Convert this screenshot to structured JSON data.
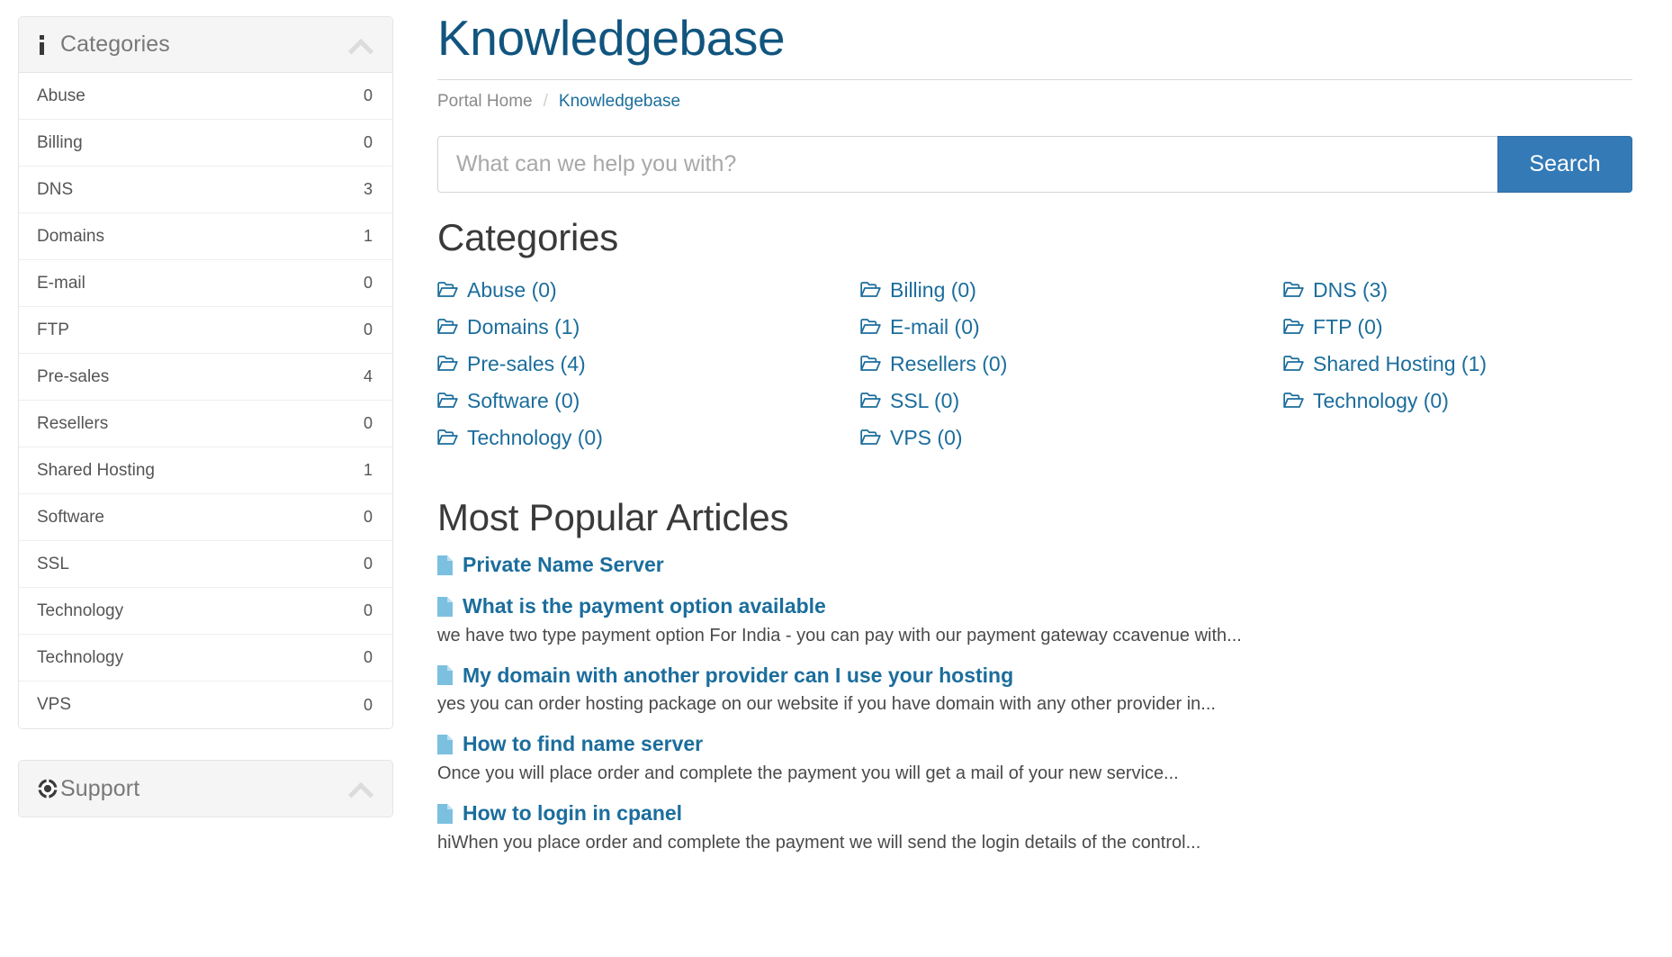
{
  "sidebar": {
    "categories_panel": {
      "icon": "info-icon",
      "title": "Categories",
      "collapse_icon": "chevron-up-icon",
      "items": [
        {
          "label": "Abuse",
          "count": "0"
        },
        {
          "label": "Billing",
          "count": "0"
        },
        {
          "label": "DNS",
          "count": "3"
        },
        {
          "label": "Domains",
          "count": "1"
        },
        {
          "label": "E-mail",
          "count": "0"
        },
        {
          "label": "FTP",
          "count": "0"
        },
        {
          "label": "Pre-sales",
          "count": "4"
        },
        {
          "label": "Resellers",
          "count": "0"
        },
        {
          "label": "Shared Hosting",
          "count": "1"
        },
        {
          "label": "Software",
          "count": "0"
        },
        {
          "label": "SSL",
          "count": "0"
        },
        {
          "label": "Technology",
          "count": "0"
        },
        {
          "label": "Technology",
          "count": "0"
        },
        {
          "label": "VPS",
          "count": "0"
        }
      ]
    },
    "support_panel": {
      "icon": "lifebuoy-icon",
      "title": "Support",
      "collapse_icon": "chevron-up-icon"
    }
  },
  "main": {
    "page_title": "Knowledgebase",
    "breadcrumb": {
      "home": "Portal Home",
      "separator": "/",
      "current": "Knowledgebase"
    },
    "search": {
      "placeholder": "What can we help you with?",
      "value": "",
      "button_label": "Search"
    },
    "categories": {
      "heading": "Categories",
      "items": [
        {
          "label": "Abuse (0)",
          "icon": "folder-open-icon"
        },
        {
          "label": "Billing (0)",
          "icon": "folder-open-icon"
        },
        {
          "label": "DNS (3)",
          "icon": "folder-open-icon"
        },
        {
          "label": "Domains (1)",
          "icon": "folder-open-icon"
        },
        {
          "label": "E-mail (0)",
          "icon": "folder-open-icon"
        },
        {
          "label": "FTP (0)",
          "icon": "folder-open-icon"
        },
        {
          "label": "Pre-sales (4)",
          "icon": "folder-open-icon"
        },
        {
          "label": "Resellers (0)",
          "icon": "folder-open-icon"
        },
        {
          "label": "Shared Hosting (1)",
          "icon": "folder-open-icon"
        },
        {
          "label": "Software (0)",
          "icon": "folder-open-icon"
        },
        {
          "label": "SSL (0)",
          "icon": "folder-open-icon"
        },
        {
          "label": "Technology (0)",
          "icon": "folder-open-icon"
        },
        {
          "label": "Technology (0)",
          "icon": "folder-open-icon"
        },
        {
          "label": "VPS (0)",
          "icon": "folder-open-icon"
        }
      ]
    },
    "articles": {
      "heading": "Most Popular Articles",
      "items": [
        {
          "title": "Private Name Server",
          "desc": "",
          "icon": "file-icon"
        },
        {
          "title": "What is the payment option available",
          "desc": "we have two type payment option For India - you can pay with our payment gateway ccavenue with...",
          "icon": "file-icon"
        },
        {
          "title": "My domain with another provider can I use your hosting",
          "desc": "yes you can order hosting package on our website if you have domain with any other provider in...",
          "icon": "file-icon"
        },
        {
          "title": "How to find name server",
          "desc": "Once you will place order and complete the payment you will get a mail of your new service...",
          "icon": "file-icon"
        },
        {
          "title": "How to login in cpanel",
          "desc": "hiWhen you place order and complete the payment we will send the login details of the control...",
          "icon": "file-icon"
        }
      ]
    }
  },
  "colors": {
    "title_blue": "#11557f",
    "link_blue": "#1b6d9c",
    "button_blue": "#337ab7",
    "panel_head_bg": "#f5f5f5",
    "file_icon_blue": "#7cc0e0"
  }
}
